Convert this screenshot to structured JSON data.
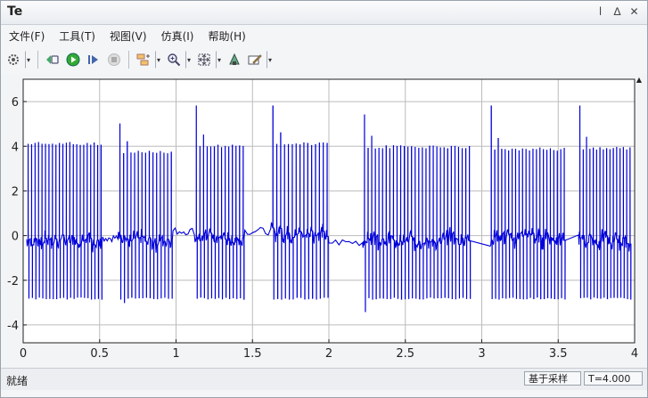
{
  "window": {
    "title": "Te"
  },
  "title_controls": {
    "pin": "ⅼ",
    "restore": "∆",
    "close": "✕"
  },
  "menu": [
    "文件(F)",
    "工具(T)",
    "视图(V)",
    "仿真(I)",
    "帮助(H)"
  ],
  "toolbar": {
    "icons": [
      "gear-icon",
      "dropdown-icon",
      "go-back-icon",
      "run-icon",
      "step-forward-icon",
      "stop-icon",
      "signal-selector-icon",
      "dropdown-icon",
      "zoom-icon",
      "dropdown-icon",
      "fit-to-view-icon",
      "dropdown-icon",
      "highlight-icon",
      "style-icon",
      "dropdown-icon"
    ]
  },
  "status": {
    "left": "就绪",
    "sample": "基于采样",
    "time": "T=4.000"
  },
  "colors": {
    "trace": "#0000d8",
    "grid": "#bcbcbc",
    "axes_bg": "#ffffff"
  },
  "chart_data": {
    "type": "line",
    "title": "",
    "xlabel": "",
    "ylabel": "",
    "xlim": [
      0,
      4
    ],
    "ylim": [
      -4.8,
      7
    ],
    "xticks": [
      0,
      0.5,
      1,
      1.5,
      2,
      2.5,
      3,
      3.5,
      4
    ],
    "xtick_labels": [
      "0",
      "0.5",
      "1",
      "1.5",
      "2",
      "2.5",
      "3",
      "3.5",
      "4"
    ],
    "yticks": [
      -4,
      -2,
      0,
      2,
      4,
      6
    ],
    "ytick_labels": [
      "-4",
      "-2",
      "0",
      "2",
      "4",
      "6"
    ],
    "grid": true,
    "series": [
      {
        "color": "#0000d8",
        "segments": [
          {
            "x_start": 0.02,
            "x_end": 0.52,
            "high": 4.1,
            "low": -2.8,
            "baseline": -0.2,
            "pulses": 22,
            "spike": 4.6
          },
          {
            "x_start": 0.62,
            "x_end": 0.98,
            "high": 3.7,
            "low": -2.8,
            "baseline": -0.2,
            "pulses": 15,
            "spike": 5.0
          },
          {
            "x_start": 1.12,
            "x_end": 1.45,
            "high": 4.0,
            "low": -2.8,
            "baseline": -0.1,
            "pulses": 14,
            "spike": 5.8
          },
          {
            "x_start": 1.62,
            "x_end": 2.0,
            "high": 4.1,
            "low": -2.8,
            "baseline": 0.1,
            "pulses": 15,
            "spike": 5.8
          },
          {
            "x_start": 2.22,
            "x_end": 2.93,
            "high": 3.95,
            "low": -2.8,
            "baseline": -0.2,
            "pulses": 30,
            "spike": 5.4
          },
          {
            "x_start": 3.05,
            "x_end": 3.55,
            "high": 3.85,
            "low": -2.8,
            "baseline": -0.1,
            "pulses": 22,
            "spike": 5.8
          },
          {
            "x_start": 3.63,
            "x_end": 3.98,
            "high": 3.9,
            "low": -2.8,
            "baseline": -0.2,
            "pulses": 16,
            "spike": 5.8
          }
        ],
        "gaps": [
          {
            "x_start": 0.52,
            "x_end": 0.62,
            "level": -0.1
          },
          {
            "x_start": 0.98,
            "x_end": 1.12,
            "level": 0.2
          },
          {
            "x_start": 1.45,
            "x_end": 1.62,
            "level": 0.2
          },
          {
            "x_start": 2.0,
            "x_end": 2.22,
            "level": -0.3
          }
        ],
        "dip_min": -3.4
      }
    ]
  }
}
